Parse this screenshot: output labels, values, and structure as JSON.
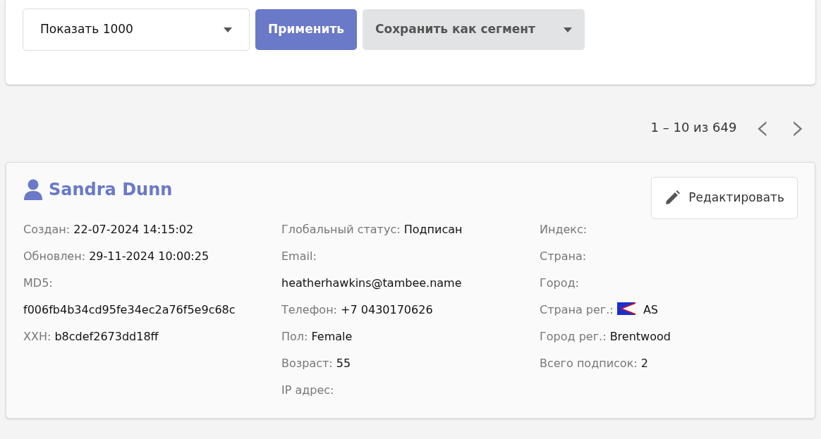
{
  "filter_bar": {
    "limit_select": {
      "value": "Показать 1000"
    },
    "apply_button": "Применить",
    "save_button": "Сохранить как сегмент"
  },
  "pagination": {
    "range": "1 – 10 из 649",
    "prev_label": "‹",
    "next_label": "›"
  },
  "contact": {
    "name": "Sandra Dunn",
    "edit_button": "Редактировать",
    "columns": [
      [
        {
          "kind": "inline",
          "label": "Создан:",
          "value": "22-07-2024 14:15:02"
        },
        {
          "kind": "inline",
          "label": "Обновлен:",
          "value": "29-11-2024 10:00:25"
        },
        {
          "kind": "stacked",
          "label": "MD5:",
          "value": "f006fb4b34cd95fe34ec2a76f5e9c68c"
        },
        {
          "kind": "inline",
          "label": "XXH:",
          "value": "b8cdef2673dd18ff"
        }
      ],
      [
        {
          "kind": "inline",
          "label": "Глобальный статус:",
          "value": "Подписан"
        },
        {
          "kind": "stacked",
          "label": "Email:",
          "value": "heatherhawkins@tambee.name"
        },
        {
          "kind": "inline",
          "label": "Телефон:",
          "value": "+7 0430170626"
        },
        {
          "kind": "inline",
          "label": "Пол:",
          "value": "Female"
        },
        {
          "kind": "inline",
          "label": "Возраст:",
          "value": "55"
        },
        {
          "kind": "label",
          "label": "IP адрес:"
        }
      ],
      [
        {
          "kind": "label",
          "label": "Индекс:"
        },
        {
          "kind": "label",
          "label": "Страна:"
        },
        {
          "kind": "label",
          "label": "Город:"
        },
        {
          "kind": "flag",
          "label": "Страна рег.:",
          "value": "AS"
        },
        {
          "kind": "inline",
          "label": "Город рег.:",
          "value": "Brentwood"
        },
        {
          "kind": "inline",
          "label": "Всего подписок:",
          "value": "2"
        }
      ]
    ]
  }
}
